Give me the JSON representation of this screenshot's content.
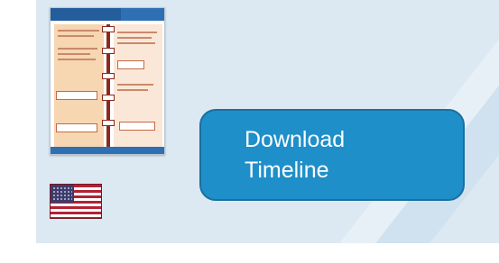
{
  "thumbnail": {
    "icon": "timeline-document-thumbnail"
  },
  "flag": {
    "icon": "us-flag-icon"
  },
  "download_button": {
    "label": "Download\nTimeline"
  },
  "colors": {
    "panel_background": "#dce9f3",
    "button_fill": "#1f8fc9",
    "button_border": "#1a6fa0",
    "button_text": "#ffffff"
  }
}
